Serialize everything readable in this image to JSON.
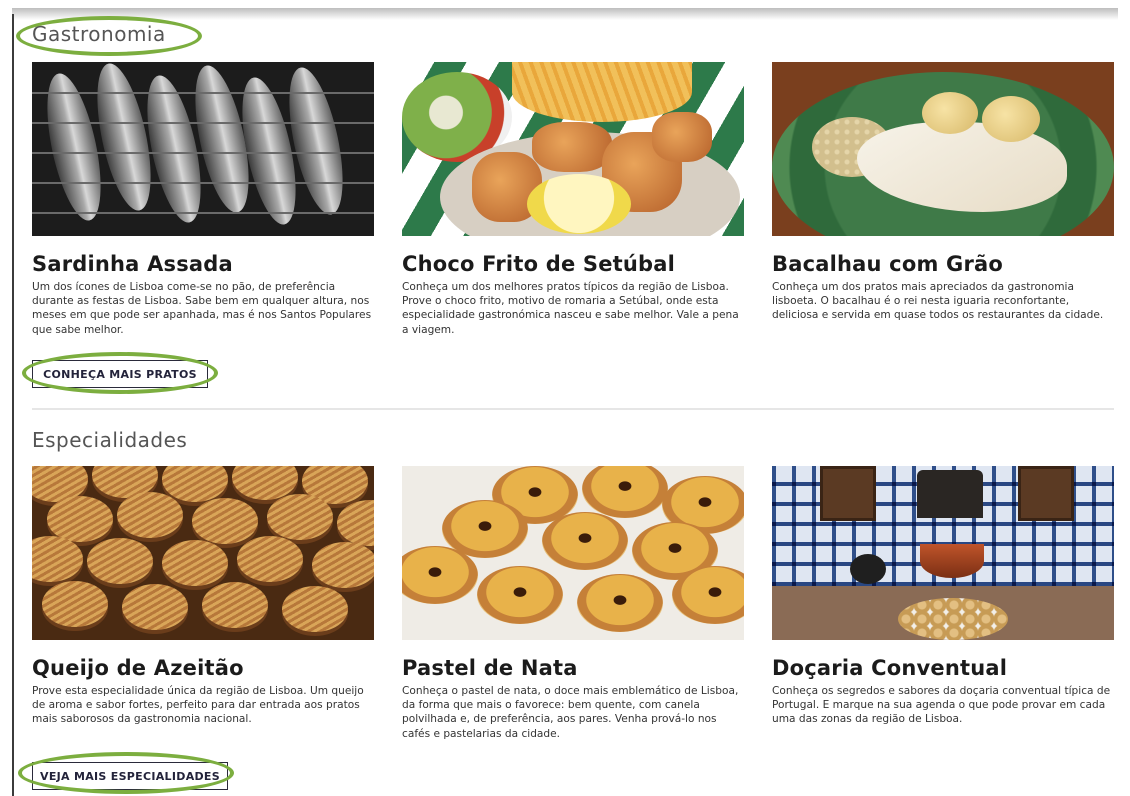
{
  "sections": {
    "gastronomia": {
      "title": "Gastronomia",
      "button": "CONHEÇA MAIS PRATOS",
      "cards": [
        {
          "title": "Sardinha Assada",
          "text": "Um dos ícones de Lisboa come-se no pão, de preferência durante as festas de Lisboa. Sabe bem em qualquer altura, nos meses em que pode ser apanhada, mas é nos Santos Populares que sabe melhor."
        },
        {
          "title": "Choco Frito de Setúbal",
          "text": "Conheça um dos melhores pratos típicos da região de Lisboa. Prove o choco frito, motivo de romaria a Setúbal, onde esta especialidade gastronómica nasceu e sabe melhor. Vale a pena a viagem."
        },
        {
          "title": "Bacalhau com Grão",
          "text": "Conheça um dos pratos mais apreciados da gastronomia lisboeta. O bacalhau é o rei nesta iguaria reconfortante, deliciosa e servida em quase todos os restaurantes da cidade."
        }
      ]
    },
    "especialidades": {
      "title": "Especialidades",
      "button": "VEJA MAIS ESPECIALIDADES",
      "cards": [
        {
          "title": "Queijo de Azeitão",
          "text": "Prove esta especialidade única da região de Lisboa. Um queijo de aroma e sabor fortes, perfeito para dar entrada aos pratos mais saborosos da gastronomia nacional."
        },
        {
          "title": "Pastel de Nata",
          "text": "Conheça o pastel de nata, o doce mais emblemático de Lisboa, da forma que mais o favorece: bem quente, com canela polvilhada e, de preferência, aos pares. Venha prová-lo nos cafés e pastelarias da cidade."
        },
        {
          "title": "Doçaria Conventual",
          "text": "Conheça os segredos e sabores da doçaria conventual típica de Portugal. E marque na sua agenda o que pode provar em cada uma das zonas da região de Lisboa."
        }
      ]
    }
  },
  "highlight_color": "#7cae3f"
}
